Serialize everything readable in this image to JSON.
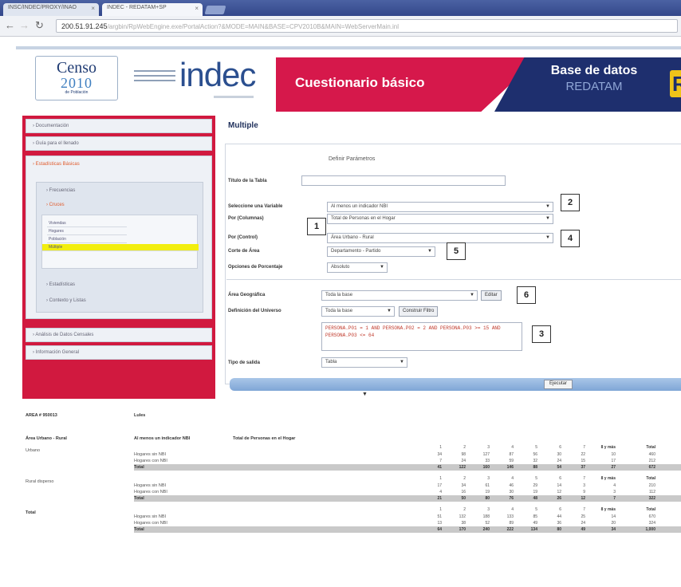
{
  "browser": {
    "tabs": [
      {
        "label": "INSC/INDEC/PROXY/INAO"
      },
      {
        "label": "INDEC - REDATAM+SP"
      }
    ],
    "url_host": "200.51.91.245",
    "url_path": "/argbin/RpWebEngine.exe/PortalAction?&MODE=MAIN&BASE=CPV2010B&MAIN=WebServerMain.inl"
  },
  "banner": {
    "censo_line1": "Censo",
    "censo_line2": "2010",
    "censo_line3": "de Población",
    "indec": "indec",
    "cuestionario": "Cuestionario básico",
    "base_datos": "Base de datos",
    "redatam": "REDATAM",
    "redatam_logo": "R"
  },
  "sidebar": {
    "items": [
      "› Documentación",
      "› Guía para el llenado",
      "› Estadísticas Básicas"
    ],
    "sub_items": [
      "› Frecuencias",
      "› Cruces",
      "› Estadísticas",
      "› Contexto y Listas"
    ],
    "leaves": [
      "Viviendas",
      "Hogares",
      "Población",
      "Múltiple"
    ],
    "bottom_items": [
      "› Análisis de Datos Censales",
      "› Información General"
    ]
  },
  "main": {
    "title": "Multiple",
    "heading": "Definir Parámetros",
    "labels": {
      "titulo": "Título de la Tabla",
      "variable": "Seleccione una Variable",
      "columnas": "Por (Columnas)",
      "control": "Por (Control)",
      "corte": "Corte de Área",
      "porcentaje": "Opciones de Porcentaje",
      "area": "Área Geográfica",
      "universo": "Definición del Universo",
      "salida": "Tipo de salida"
    },
    "values": {
      "variable": "Al menos un indicador NBI",
      "columnas": "Total de Personas en el Hogar",
      "control": "Área Urbano - Rural",
      "corte": "Departamento - Partido",
      "porcentaje": "Absoluto",
      "area": "Toda la base",
      "universo": "Toda la base",
      "salida": "Tabla"
    },
    "buttons": {
      "editar": "Editar",
      "filtro": "Construir Filtro",
      "ejecutar": "Ejecutar"
    },
    "filter_text": "PERSONA.P01 = 1 AND PERSONA.P02 = 2 AND PERSONA.P03 >= 15 AND PERSONA.P03 <= 64"
  },
  "callouts": [
    "1",
    "2",
    "3",
    "4",
    "5",
    "6"
  ],
  "results": {
    "area_code": "AREA # 950013",
    "area_name": "Lules",
    "col1_header": "Área Urbano - Rural",
    "col2_header": "Al menos un indicador NBI",
    "col3_header": "Total de Personas en el Hogar",
    "columns": [
      "1",
      "2",
      "3",
      "4",
      "5",
      "6",
      "7",
      "8 y más",
      "Total"
    ],
    "blocks": [
      {
        "name": "Urbano",
        "rows": [
          {
            "label": "Hogares sin NBI",
            "values": [
              "34",
              "98",
              "127",
              "87",
              "56",
              "30",
              "22",
              "10",
              "460"
            ]
          },
          {
            "label": "Hogares con NBI",
            "values": [
              "7",
              "24",
              "33",
              "59",
              "32",
              "24",
              "15",
              "17",
              "212"
            ]
          },
          {
            "label": "Total",
            "values": [
              "41",
              "122",
              "160",
              "146",
              "88",
              "54",
              "37",
              "27",
              "672"
            ]
          }
        ]
      },
      {
        "name": "Rural disperso",
        "rows": [
          {
            "label": "Hogares sin NBI",
            "values": [
              "17",
              "34",
              "61",
              "46",
              "29",
              "14",
              "3",
              "4",
              "210"
            ]
          },
          {
            "label": "Hogares con NBI",
            "values": [
              "4",
              "16",
              "19",
              "30",
              "19",
              "12",
              "9",
              "3",
              "112"
            ]
          },
          {
            "label": "Total",
            "values": [
              "21",
              "50",
              "80",
              "76",
              "48",
              "26",
              "12",
              "7",
              "322"
            ]
          }
        ]
      },
      {
        "name": "Total",
        "rows": [
          {
            "label": "Hogares sin NBI",
            "values": [
              "51",
              "132",
              "188",
              "133",
              "85",
              "44",
              "25",
              "14",
              "670"
            ]
          },
          {
            "label": "Hogares con NBI",
            "values": [
              "13",
              "38",
              "52",
              "89",
              "49",
              "36",
              "24",
              "20",
              "324"
            ]
          },
          {
            "label": "Total",
            "values": [
              "64",
              "170",
              "240",
              "222",
              "134",
              "80",
              "49",
              "34",
              "1,000"
            ]
          }
        ]
      }
    ]
  }
}
